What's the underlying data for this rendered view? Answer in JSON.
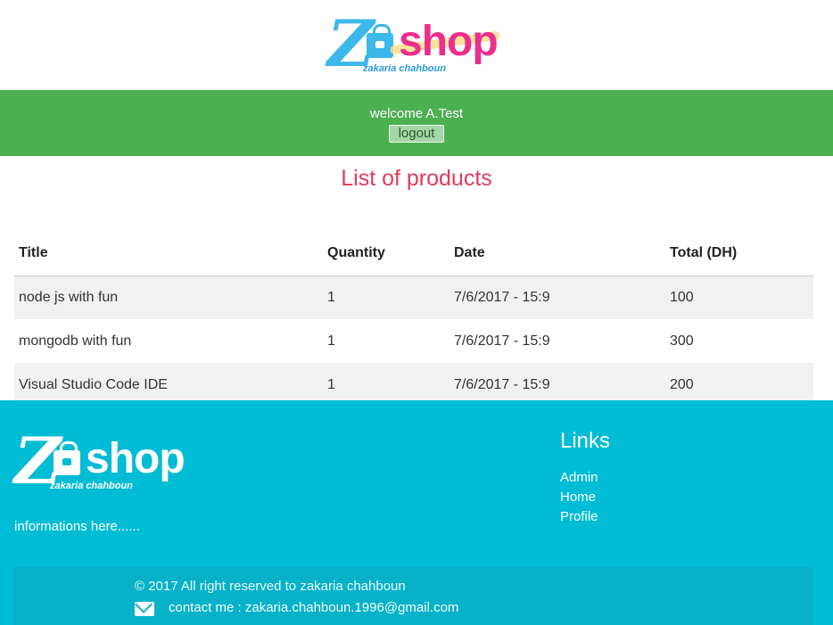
{
  "brand": {
    "letter": "Z",
    "word": "shop",
    "author": "zakaria chahboun"
  },
  "userbar": {
    "welcome": "welcome A.Test",
    "logout_label": "logout"
  },
  "main": {
    "title": "List of products",
    "columns": [
      "Title",
      "Quantity",
      "Date",
      "Total (DH)"
    ],
    "rows": [
      [
        "node js with fun",
        "1",
        "7/6/2017 - 15:9",
        "100"
      ],
      [
        "mongodb with fun",
        "1",
        "7/6/2017 - 15:9",
        "300"
      ],
      [
        "Visual Studio Code IDE",
        "1",
        "7/6/2017 - 15:9",
        "200"
      ]
    ]
  },
  "footer": {
    "info": "informations here......",
    "links_title": "Links",
    "links": [
      "Admin",
      "Home",
      "Profile"
    ],
    "copyright": "© 2017 All right reserved to zakaria chahboun",
    "contact": "contact me : zakaria.chahboun.1996@gmail.com"
  },
  "icons": {
    "mail": "envelope-icon",
    "bag": "shopping-bag-icon"
  },
  "colors": {
    "userbar": "#4caf50",
    "footer": "#00bcd4",
    "title": "#e03b5b",
    "logo_blue": "#3cb8ea",
    "logo_pink": "#ec2f8f"
  }
}
